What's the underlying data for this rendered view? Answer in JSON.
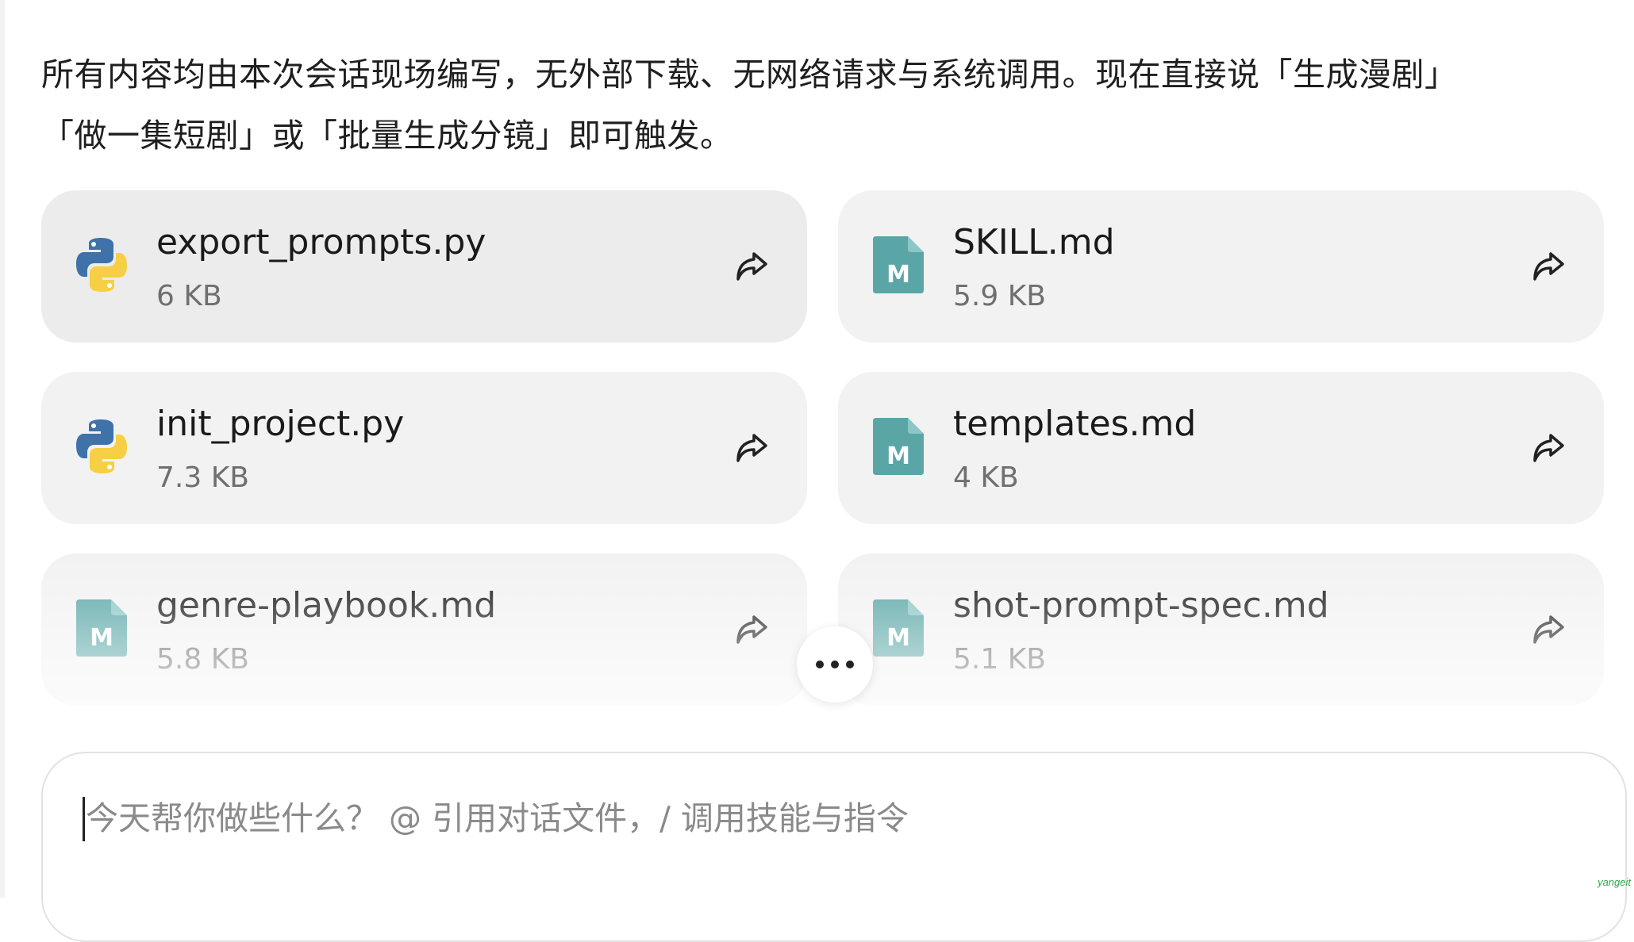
{
  "message": {
    "line1": "所有内容均由本次会话现场编写，无外部下载、无网络请求与系统调用。现在直接说「生成漫剧」",
    "line2": "「做一集短剧」或「批量生成分镜」即可触发。"
  },
  "files": [
    {
      "name": "export_prompts.py",
      "size": "6 KB",
      "icon": "python-icon"
    },
    {
      "name": "SKILL.md",
      "size": "5.9 KB",
      "icon": "markdown-icon"
    },
    {
      "name": "init_project.py",
      "size": "7.3 KB",
      "icon": "python-icon"
    },
    {
      "name": "templates.md",
      "size": "4 KB",
      "icon": "markdown-icon"
    },
    {
      "name": "genre-playbook.md",
      "size": "5.8 KB",
      "icon": "markdown-icon"
    },
    {
      "name": "shot-prompt-spec.md",
      "size": "5.1 KB",
      "icon": "markdown-icon"
    }
  ],
  "more_button": {
    "icon": "ellipsis-icon"
  },
  "composer": {
    "placeholder": "今天帮你做些什么？ @ 引用对话文件，/ 调用技能与指令"
  },
  "watermark": "yangeit",
  "colors": {
    "card_bg": "#f2f2f2",
    "markdown_icon": "#5aa6a6",
    "python_blue": "#3e72a8",
    "python_yellow": "#f6cf45"
  }
}
